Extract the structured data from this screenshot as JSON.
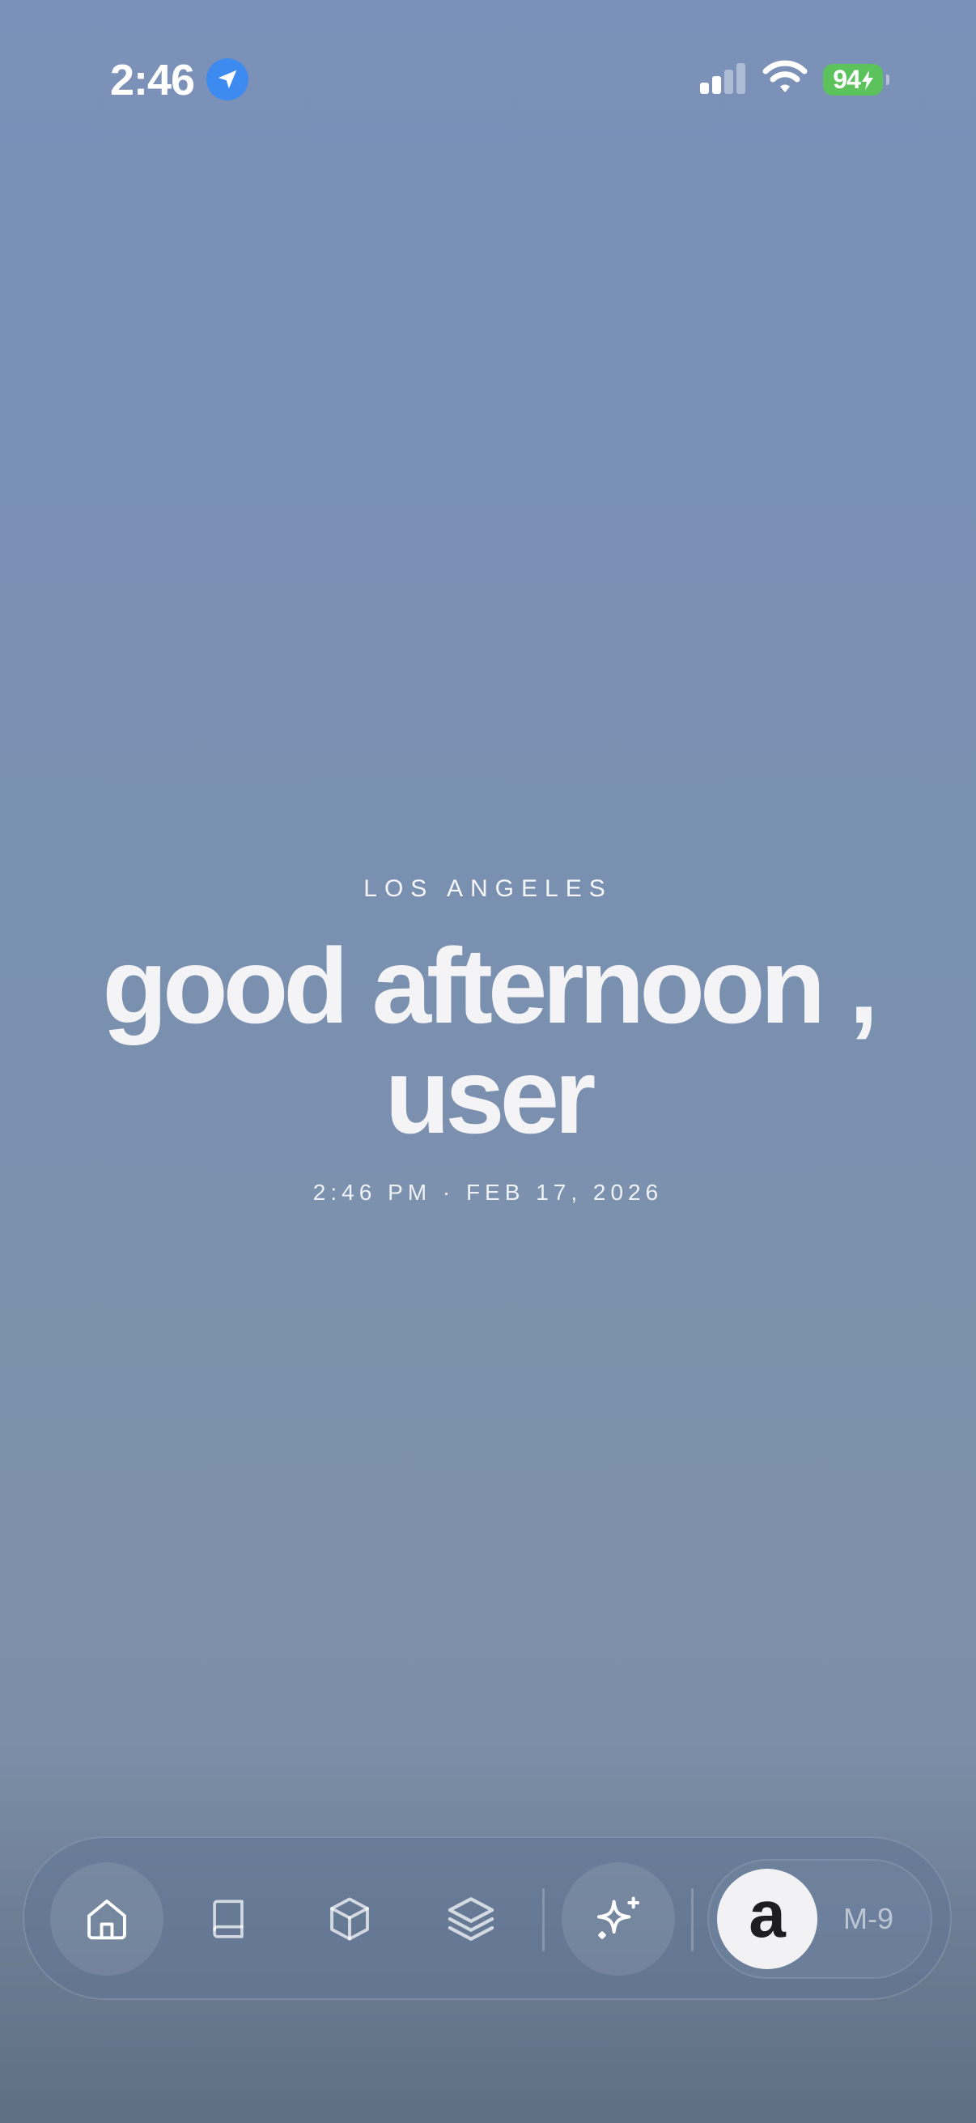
{
  "status_bar": {
    "time": "2:46",
    "battery_level": "94",
    "icons": [
      "location-arrow-icon",
      "cellular-signal-icon",
      "wifi-icon",
      "battery-icon",
      "charging-bolt-icon"
    ],
    "signal_bars_active": 2,
    "signal_bars_total": 4
  },
  "greeting": {
    "city": "LOS ANGELES",
    "line1": "good afternoon ,",
    "line2": "user",
    "datetime": "2:46 PM · FEB 17, 2026"
  },
  "dock": {
    "items": [
      {
        "icon": "home-icon",
        "active": true
      },
      {
        "icon": "book-icon",
        "active": false
      },
      {
        "icon": "cube-icon",
        "active": false
      },
      {
        "icon": "layers-icon",
        "active": false
      },
      {
        "icon": "sparkle-icon",
        "active": false
      }
    ],
    "account": {
      "avatar_letter": "a",
      "label": "M-9"
    }
  },
  "colors": {
    "background_top": "#7b91b9",
    "background_bottom": "#5f6e82",
    "location_badge": "#3d8af0",
    "battery": "#5bc25c"
  }
}
